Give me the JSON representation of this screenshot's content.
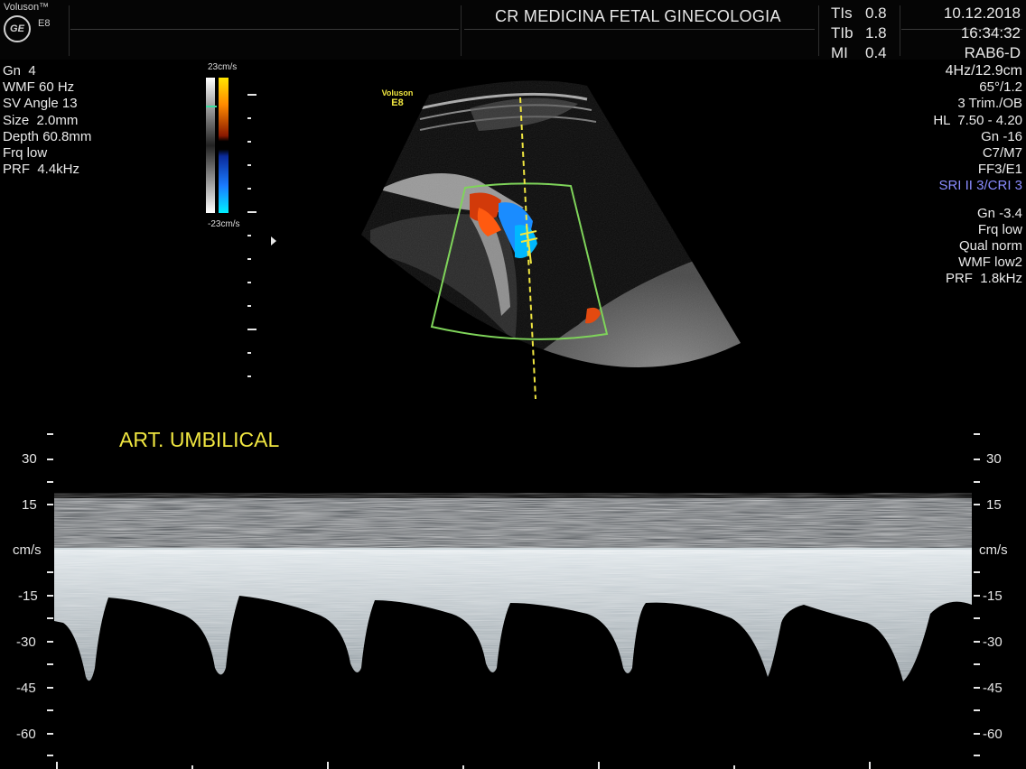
{
  "header": {
    "brand": "Voluson™",
    "logo_text": "GE",
    "model": "E8",
    "institution": "CR MEDICINA FETAL GINECOLOGIA",
    "indices": [
      {
        "label": "TIs",
        "value": "0.8"
      },
      {
        "label": "TIb",
        "value": "1.8"
      },
      {
        "label": "MI",
        "value": "0.4"
      }
    ],
    "date": "10.12.2018",
    "time": "16:34:32",
    "probe": "RAB6-D"
  },
  "left_params": [
    "Gn  4",
    "WMF 60 Hz",
    "SV Angle 13",
    "Size  2.0mm",
    "Depth 60.8mm",
    "Frq low",
    "PRF  4.4kHz"
  ],
  "right_params": [
    "4Hz/12.9cm",
    "65°/1.2",
    "3 Trim./OB",
    "HL  7.50 - 4.20",
    "Gn -16",
    "C7/M7",
    "FF3/E1",
    "SRI II 3/CRI 3"
  ],
  "right_params2": [
    "Gn -3.4",
    "Frq low",
    "Qual norm",
    "WMF low2",
    "PRF  1.8kHz"
  ],
  "color_scale": {
    "top": "23cm/s",
    "bottom": "-23cm/s"
  },
  "image_watermark": {
    "line1": "Voluson",
    "line2": "E8"
  },
  "doppler": {
    "label": "ART. UMBILICAL",
    "unit": "cm/s",
    "ticks_left": [
      "30",
      "15",
      "cm/s",
      "-15",
      "-30",
      "-45",
      "-60"
    ],
    "ticks_right": [
      "30",
      "15",
      "cm/s",
      "-15",
      "-30",
      "-45",
      "-60"
    ]
  },
  "colors": {
    "accent_yellow": "#f0e640",
    "highlight_blue": "#8a8cff",
    "roi_green": "#7fd45a"
  }
}
